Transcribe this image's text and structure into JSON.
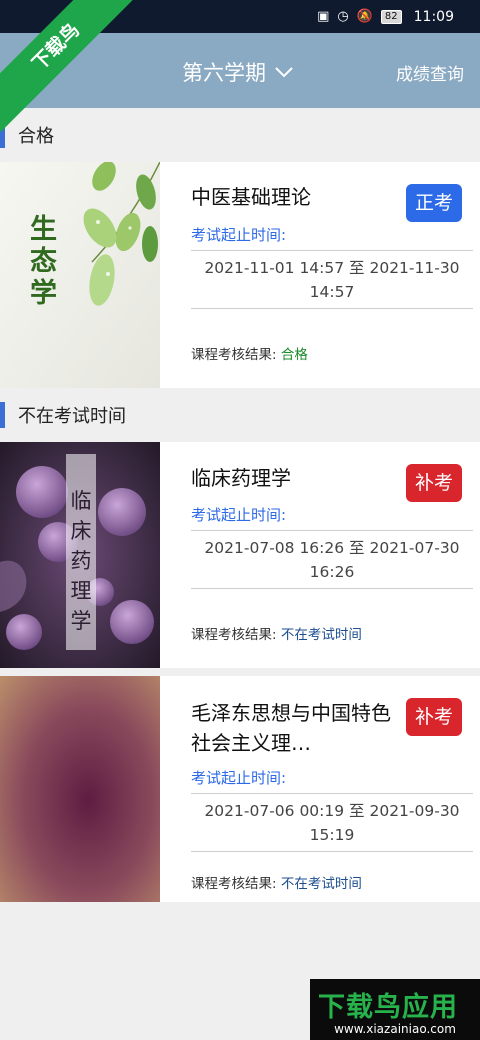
{
  "status_bar": {
    "battery": "82",
    "time": "11:09"
  },
  "header": {
    "term": "第六学期",
    "grade_query": "成绩查询"
  },
  "watermark": {
    "ribbon": "下载鸟",
    "logo": "下载鸟应用",
    "url": "www.xiazainiao.com"
  },
  "colors": {
    "header": "#8aa9c2",
    "accent": "#3c6fd6",
    "badge_regular": "#2c6ae8",
    "badge_makeup": "#d9262c",
    "pass": "#1c8a2c"
  },
  "sections": [
    {
      "title": "合格",
      "cards": [
        {
          "thumb_text": "生态学",
          "name": "中医基础理论",
          "badge": "正考",
          "time_label": "考试起止时间:",
          "time_range": "2021-11-01 14:57 至 2021-11-30 14:57",
          "result_label": "课程考核结果:",
          "result": "合格"
        }
      ]
    },
    {
      "title": "不在考试时间",
      "cards": [
        {
          "thumb_text": "临床药理学",
          "name": "临床药理学",
          "badge": "补考",
          "time_label": "考试起止时间:",
          "time_range": "2021-07-08 16:26 至 2021-07-30 16:26",
          "result_label": "课程考核结果:",
          "result": "不在考试时间"
        },
        {
          "name": "毛泽东思想与中国特色社会主义理…",
          "badge": "补考",
          "time_label": "考试起止时间:",
          "time_range": "2021-07-06 00:19 至 2021-09-30 15:19",
          "result_label": "课程考核结果:",
          "result": "不在考试时间"
        }
      ]
    }
  ]
}
